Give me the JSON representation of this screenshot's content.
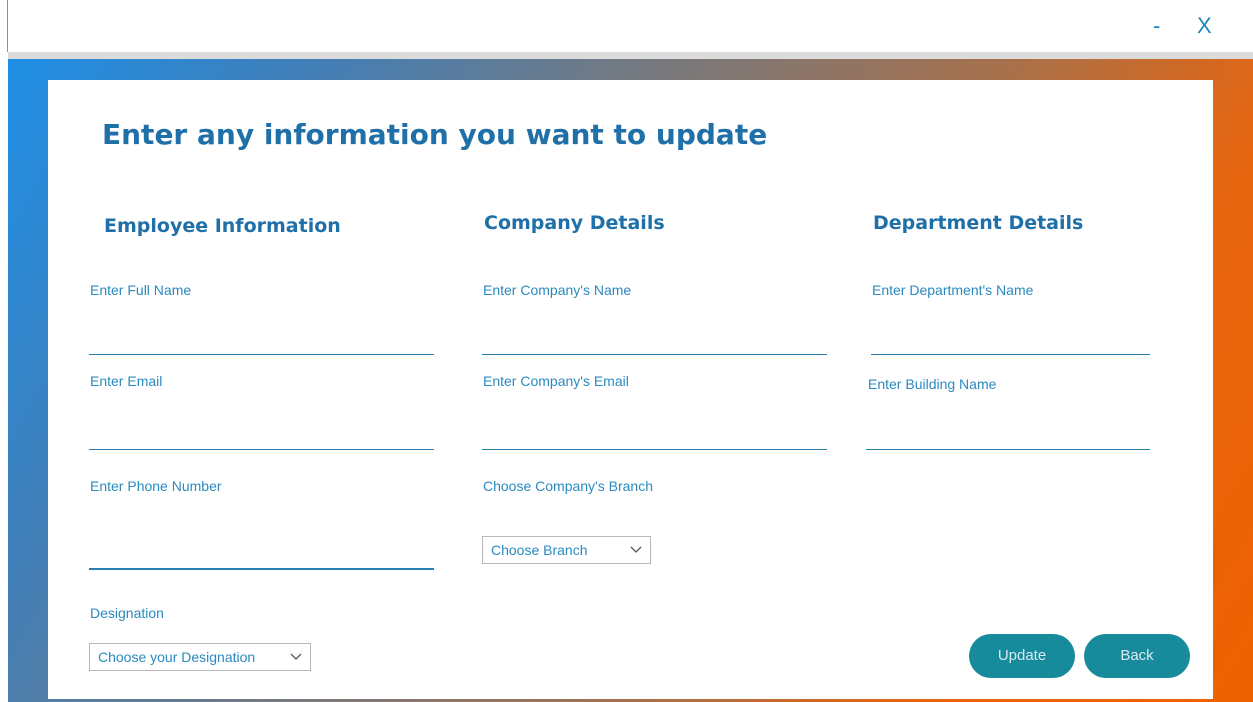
{
  "window": {
    "minimize_label": "-",
    "close_label": "X"
  },
  "form": {
    "title": "Enter any information you want to update",
    "employee": {
      "heading": "Employee Information",
      "full_name_label": "Enter Full Name",
      "email_label": "Enter Email",
      "phone_label": "Enter Phone Number",
      "designation_label": "Designation",
      "designation_select": "Choose your Designation"
    },
    "company": {
      "heading": "Company Details",
      "name_label": "Enter Company's Name",
      "email_label": "Enter Company's Email",
      "branch_label": "Choose Company's Branch",
      "branch_select": "Choose Branch"
    },
    "department": {
      "heading": "Department Details",
      "name_label": "Enter Department's Name",
      "building_label": "Enter Building Name"
    },
    "buttons": {
      "update": "Update",
      "back": "Back"
    }
  },
  "colors": {
    "accent_blue": "#1f6fa8",
    "label_blue": "#2a8abf",
    "button_teal": "#178a9c",
    "gradient_start": "#1e8fe6",
    "gradient_end": "#ee6100"
  }
}
